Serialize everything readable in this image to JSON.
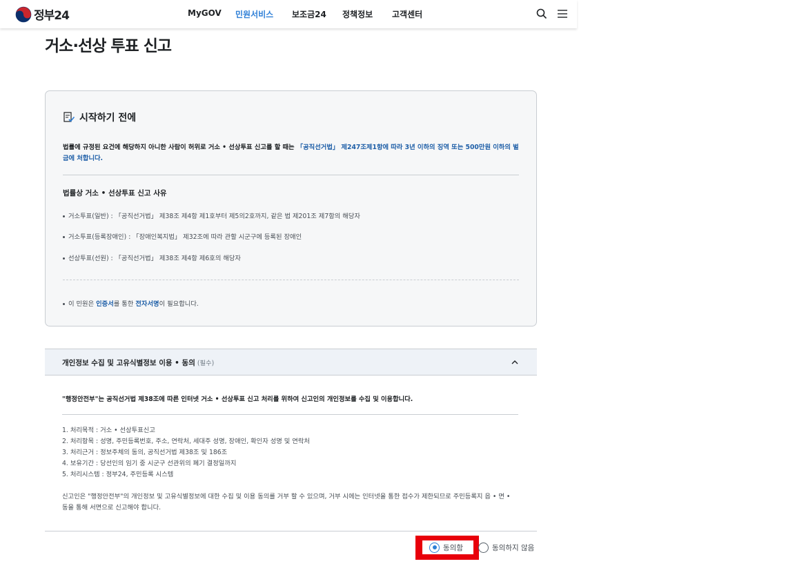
{
  "header": {
    "logo_text": "정부24",
    "nav": [
      {
        "label": "MyGOV",
        "active": false
      },
      {
        "label": "민원서비스",
        "active": true
      },
      {
        "label": "보조금24",
        "active": false
      },
      {
        "label": "정책정보",
        "active": false
      },
      {
        "label": "고객센터",
        "active": false
      }
    ],
    "icons": [
      "search-icon",
      "menu-icon"
    ]
  },
  "page_title": "거소·선상 투표 신고",
  "notice": {
    "title": "시작하기 전에",
    "warning_plain": "법률에 규정된 요건에 해당하지 아니한 사람이 허위로 거소 • 선상투표 신고를 할 때는 ",
    "warning_highlight": "「공직선거법」 제247조제1항에 따라 3년 이하의 징역 또는 500만원 이하의 벌금에 처합니다.",
    "reasons_title": "법률상 거소 • 선상투표 신고 사유",
    "reasons": [
      "거소투표(일반) : 「공직선거법」 제38조 제4항 제1호부터 제5의2호까지, 같은 법 제201조 제7항의 해당자",
      "거소투표(등록장애인) : 「장애인복지법」 제32조에 따라 관할 시군구에 등록된 장애인",
      "선상투표(선원) : 「공직선거법」 제38조 제4항 제6호의 해당자"
    ],
    "cert_pre": "이 민원은 ",
    "cert_strong1": "인증서",
    "cert_mid": "를 통한 ",
    "cert_strong2": "전자서명",
    "cert_post": "이 필요합니다."
  },
  "consent": {
    "title": "개인정보 수집 및 고유식별정보 이용 • 동의",
    "required": "(필수)",
    "agency_statement": "\"행정안전부\"는 공직선거법 제38조에 따른 인터넷 거소 • 선상투표 신고 처리를 위하여 신고인의 개인정보를 수집 및 이용합니다.",
    "items": [
      "1. 처리목적 : 거소 • 선상투표신고",
      "2. 처리항목 : 성명, 주민등록번호, 주소, 연락처, 세대주 성명, 장애인, 확인자 성명 및 연락처",
      "3. 처리근거 : 정보주체의 동의, 공직선거법 제38조 및 186조",
      "4. 보유기간 : 당선인의 임기 중 시군구 선관위의 폐기 결정일까지",
      "5. 처리시스템 : 정부24, 주민등록 시스템"
    ],
    "refusal_notice": "신고인은 \"행정안전부\"의 개인정보 및 고유식별정보에 대한 수집 및 이용 동의를 거부 할 수 있으며, 거부 시에는 인터넷을 통한 접수가 제한되므로 주민등록지 읍 • 면 • 동을 통해 서면으로 신고해야 합니다.",
    "options": [
      {
        "label": "동의함",
        "checked": true
      },
      {
        "label": "동의하지 않음",
        "checked": false
      }
    ]
  },
  "colors": {
    "accent": "#2e7fd7",
    "highlight_box": "#e8000b",
    "link": "#2060a8"
  }
}
